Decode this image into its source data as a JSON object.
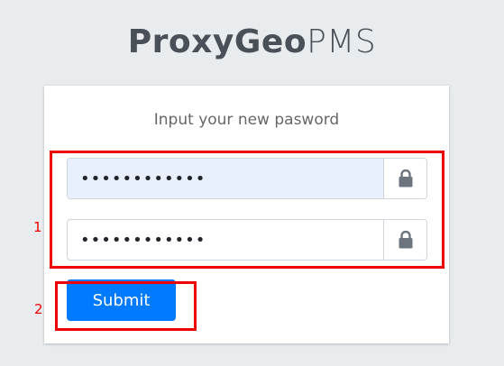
{
  "brand": {
    "bold": "ProxyGeo",
    "light": "PMS"
  },
  "card": {
    "message": "Input your new pasword"
  },
  "fields": {
    "password": {
      "value": "••••••••••••",
      "icon": "lock-icon"
    },
    "confirm_password": {
      "value": "••••••••••••",
      "icon": "lock-icon"
    }
  },
  "submit_label": "Submit",
  "annotations": {
    "label_1": "1",
    "label_2": "2",
    "color": "#ee0000"
  },
  "colors": {
    "primary": "#007bff",
    "background": "#e9ecef",
    "autofill": "#e8f0fe"
  }
}
